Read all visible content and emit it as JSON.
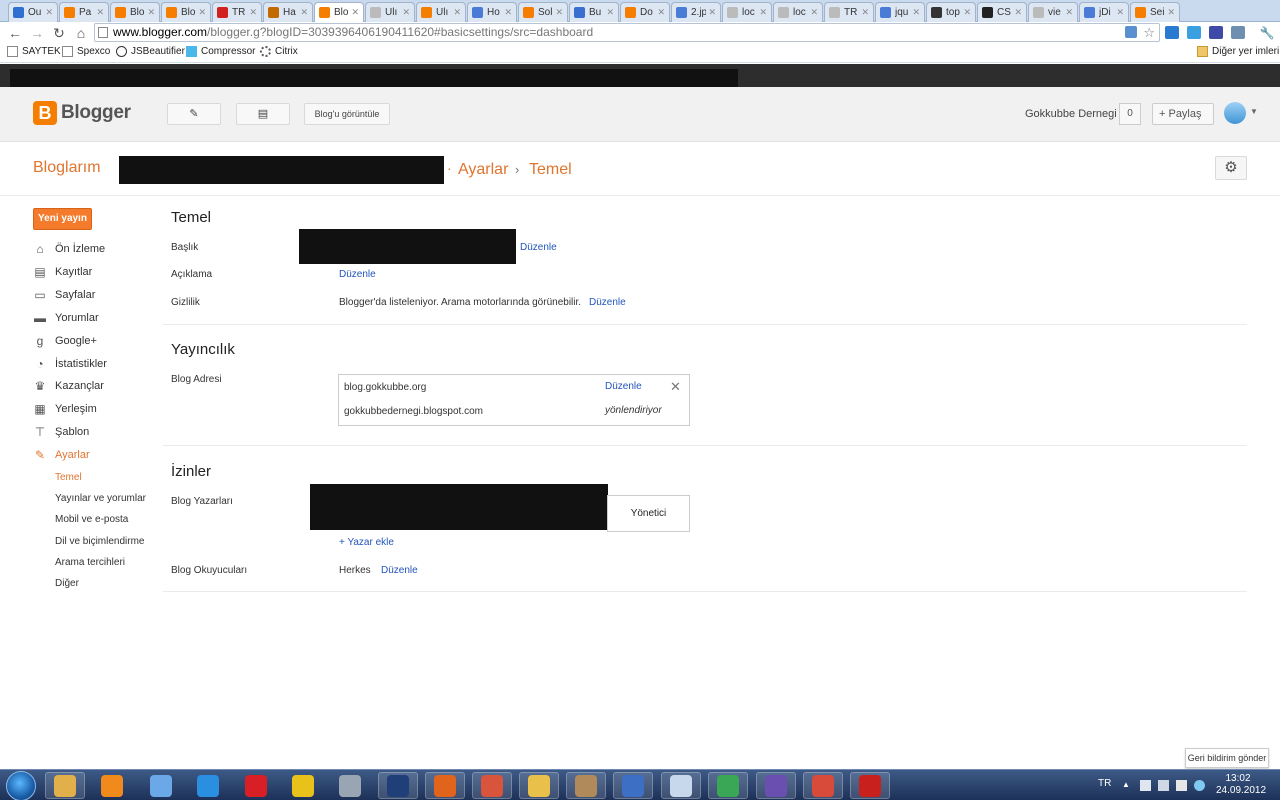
{
  "tabs": [
    {
      "title": "Ou",
      "color": "#2f6fd0"
    },
    {
      "title": "Pa",
      "color": "#f57d00"
    },
    {
      "title": "Blo",
      "color": "#f57d00"
    },
    {
      "title": "Blo",
      "color": "#f57d00"
    },
    {
      "title": "TR",
      "color": "#d02020"
    },
    {
      "title": "Ha",
      "color": "#c26a00"
    },
    {
      "title": "Blo",
      "color": "#f57d00",
      "active": true
    },
    {
      "title": "Ulı",
      "color": "#bbbbbb"
    },
    {
      "title": "Ulı",
      "color": "#f57d00"
    },
    {
      "title": "Ho",
      "color": "#4a7bd6"
    },
    {
      "title": "Sol",
      "color": "#f57d00"
    },
    {
      "title": "Bu",
      "color": "#3a6fd0"
    },
    {
      "title": "Do",
      "color": "#f57d00"
    },
    {
      "title": "2.jp",
      "color": "#4a7bd6"
    },
    {
      "title": "loc",
      "color": "#bbbbbb"
    },
    {
      "title": "loc",
      "color": "#bbbbbb"
    },
    {
      "title": "TR",
      "color": "#bbbbbb"
    },
    {
      "title": "jqu",
      "color": "#4a7bd6"
    },
    {
      "title": "top",
      "color": "#333333"
    },
    {
      "title": "CS",
      "color": "#222222"
    },
    {
      "title": "vie",
      "color": "#bbbbbb"
    },
    {
      "title": "jDi",
      "color": "#4a7bd6"
    },
    {
      "title": "Sei",
      "color": "#f57d00"
    }
  ],
  "address": {
    "host": "www.blogger.com",
    "path": "/blogger.g?blogID=3039396406190411620#basicsettings/src=dashboard"
  },
  "bookmarks": [
    "SAYTEK",
    "Spexco",
    "JSBeautifier",
    "Compressor",
    "Citrix"
  ],
  "other_bookmarks": "Diğer yer imleri",
  "header": {
    "logo_text": "Blogger",
    "view_blog": "Blog'u görüntüle",
    "user_name": "Gokkubbe Dernegi",
    "notif_count": "0",
    "share": "+ Paylaş"
  },
  "breadcrumb": {
    "my_blogs": "Bloglarım",
    "dot": "·",
    "settings": "Ayarlar",
    "sep": "›",
    "current": "Temel"
  },
  "sidebar": {
    "new_post": "Yeni yayın",
    "items": [
      {
        "label": "Ön İzleme",
        "icon": "home-icon",
        "glyph": "⌂"
      },
      {
        "label": "Kayıtlar",
        "icon": "posts-icon",
        "glyph": "▤"
      },
      {
        "label": "Sayfalar",
        "icon": "pages-icon",
        "glyph": "▭"
      },
      {
        "label": "Yorumlar",
        "icon": "comments-icon",
        "glyph": "▬"
      },
      {
        "label": "Google+",
        "icon": "google-plus-icon",
        "glyph": "g"
      },
      {
        "label": "İstatistikler",
        "icon": "stats-icon",
        "glyph": "◔"
      },
      {
        "label": "Kazançlar",
        "icon": "trophy-icon",
        "glyph": "♛"
      },
      {
        "label": "Yerleşim",
        "icon": "layout-icon",
        "glyph": "▦"
      },
      {
        "label": "Şablon",
        "icon": "template-icon",
        "glyph": "⊤"
      },
      {
        "label": "Ayarlar",
        "icon": "wrench-icon",
        "glyph": "✎",
        "active": true
      }
    ],
    "sub_items": [
      {
        "label": "Temel",
        "active": true
      },
      {
        "label": "Yayınlar ve yorumlar"
      },
      {
        "label": "Mobil ve e-posta"
      },
      {
        "label": "Dil ve biçimlendirme"
      },
      {
        "label": "Arama tercihleri"
      },
      {
        "label": "Diğer"
      }
    ]
  },
  "basic": {
    "title": "Temel",
    "title_label": "Başlık",
    "title_edit": "Düzenle",
    "desc_label": "Açıklama",
    "desc_edit": "Düzenle",
    "privacy_label": "Gizlilik",
    "privacy_value": "Blogger'da listeleniyor. Arama motorlarında görünebilir.",
    "privacy_edit": "Düzenle"
  },
  "publishing": {
    "title": "Yayıncılık",
    "address_label": "Blog Adresi",
    "custom_domain": "blog.gokkubbe.org",
    "domain_edit": "Düzenle",
    "blogspot": "gokkubbedernegi.blogspot.com",
    "redirecting": "yönlendiriyor"
  },
  "permissions": {
    "title": "İzinler",
    "authors_label": "Blog Yazarları",
    "role": "Yönetici",
    "add_author": "+ Yazar ekle",
    "readers_label": "Blog Okuyucuları",
    "readers_value": "Herkes",
    "readers_edit": "Düzenle"
  },
  "feedback": "Geri bildirim gönder",
  "taskbar": {
    "lang": "TR",
    "time": "13:02",
    "date": "24.09.2012",
    "apps": [
      {
        "name": "explorer",
        "color": "#e2b04a"
      },
      {
        "name": "media-player",
        "color": "#f08a1c"
      },
      {
        "name": "safari",
        "color": "#6aa8e8"
      },
      {
        "name": "internet-explorer",
        "color": "#2a8fe0"
      },
      {
        "name": "opera",
        "color": "#d81f26"
      },
      {
        "name": "norton-commander",
        "color": "#e8c21a"
      },
      {
        "name": "tools",
        "color": "#9aa5b3"
      },
      {
        "name": "photoshop",
        "color": "#1f3f78"
      },
      {
        "name": "firefox",
        "color": "#e0641c"
      },
      {
        "name": "app-red",
        "color": "#d8543c"
      },
      {
        "name": "outlook",
        "color": "#e8c04a"
      },
      {
        "name": "winrar",
        "color": "#b08a5a"
      },
      {
        "name": "remote-desktop",
        "color": "#3d6fc4"
      },
      {
        "name": "window",
        "color": "#c8d8ec"
      },
      {
        "name": "chrome",
        "color": "#3aa757"
      },
      {
        "name": "visual-studio",
        "color": "#6a4fb0"
      },
      {
        "name": "app-pdf",
        "color": "#d84a3a"
      },
      {
        "name": "filezilla",
        "color": "#c8201c"
      }
    ]
  }
}
